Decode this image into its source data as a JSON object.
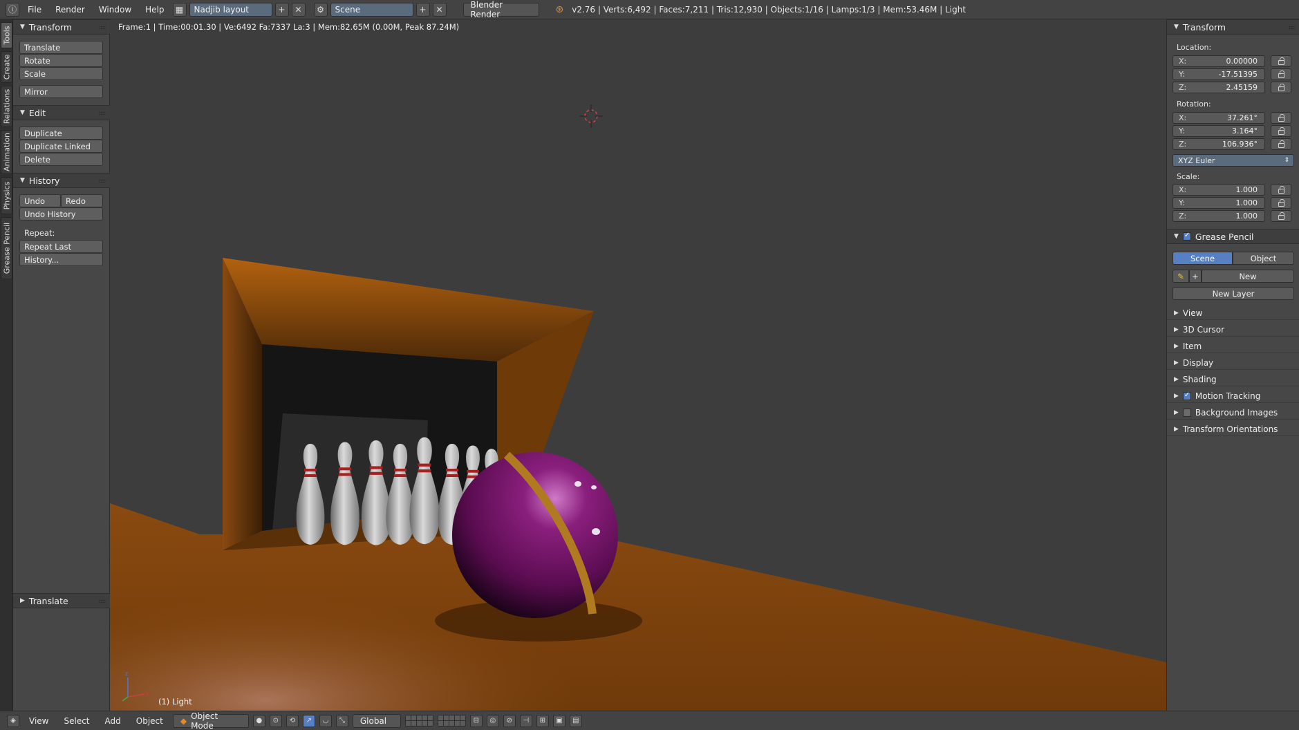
{
  "topbar": {
    "menus": [
      "File",
      "Render",
      "Window",
      "Help"
    ],
    "layout_name": "Nadjib layout",
    "scene_name": "Scene",
    "engine": "Blender Render",
    "stats": "v2.76 | Verts:6,492 | Faces:7,211 | Tris:12,930 | Objects:1/16 | Lamps:1/3 | Mem:53.46M | Light"
  },
  "tabs": [
    "Tools",
    "Create",
    "Relations",
    "Animation",
    "Physics",
    "Grease Pencil"
  ],
  "toolshelf": {
    "transform": {
      "title": "Transform",
      "buttons": [
        "Translate",
        "Rotate",
        "Scale",
        "Mirror"
      ]
    },
    "edit": {
      "title": "Edit",
      "buttons": [
        "Duplicate",
        "Duplicate Linked",
        "Delete"
      ]
    },
    "history": {
      "title": "History",
      "undo": "Undo",
      "redo": "Redo",
      "undo_history": "Undo History",
      "repeat_label": "Repeat:",
      "repeat_last": "Repeat Last",
      "history_btn": "History..."
    },
    "last_op": "Translate"
  },
  "viewport": {
    "info": "Frame:1 | Time:00:01.30 | Ve:6492 Fa:7337 La:3 | Mem:82.65M (0.00M, Peak 87.24M)",
    "object_label": "(1) Light",
    "colors": {
      "lane": "#8a4a10",
      "ball": "#7a1a6e",
      "ball_stripe": "#b07a20",
      "pin": "#d0d0d0",
      "pin_stripe": "#a82020"
    }
  },
  "props": {
    "transform": {
      "title": "Transform",
      "location_label": "Location:",
      "location": {
        "x": "0.00000",
        "y": "-17.51395",
        "z": "2.45159"
      },
      "rotation_label": "Rotation:",
      "rotation": {
        "x": "37.261°",
        "y": "3.164°",
        "z": "106.936°"
      },
      "rotation_mode": "XYZ Euler",
      "scale_label": "Scale:",
      "scale": {
        "x": "1.000",
        "y": "1.000",
        "z": "1.000"
      }
    },
    "axis": {
      "x": "X:",
      "y": "Y:",
      "z": "Z:"
    },
    "grease": {
      "title": "Grease Pencil",
      "scene": "Scene",
      "object": "Object",
      "new": "New",
      "new_layer": "New Layer"
    },
    "collapsed": [
      "View",
      "3D Cursor",
      "Item",
      "Display",
      "Shading",
      "Motion Tracking",
      "Background Images",
      "Transform Orientations"
    ]
  },
  "bottombar": {
    "menus": [
      "View",
      "Select",
      "Add",
      "Object"
    ],
    "mode": "Object Mode",
    "orientation": "Global"
  }
}
